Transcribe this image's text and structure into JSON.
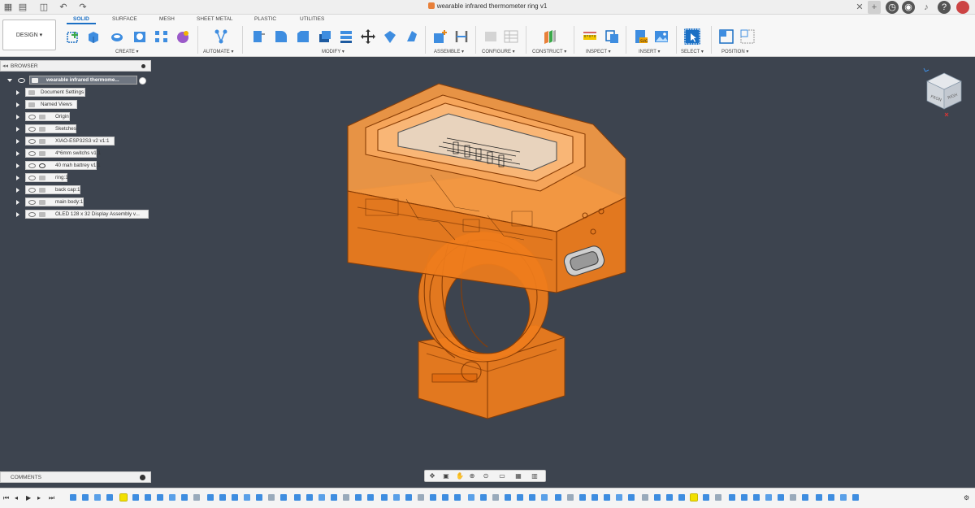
{
  "window": {
    "title": "wearable infrared thermometer ring v1"
  },
  "ribbon": {
    "workspace_button": "DESIGN ▾",
    "tabs": [
      "SOLID",
      "SURFACE",
      "MESH",
      "SHEET METAL",
      "PLASTIC",
      "UTILITIES"
    ],
    "active_tab": "SOLID",
    "groups": [
      "CREATE ▾",
      "AUTOMATE ▾",
      "MODIFY ▾",
      "ASSEMBLE ▾",
      "CONFIGURE ▾",
      "CONSTRUCT ▾",
      "INSPECT ▾",
      "INSERT ▾",
      "SELECT ▾",
      "POSITION ▾"
    ]
  },
  "browser": {
    "header": "BROWSER",
    "root": "wearable infrared thermome...",
    "items": [
      "Document Settings",
      "Named Views",
      "Origin",
      "Sketches",
      "XIAO-ESP32S3 v2 v1:1",
      "4*6mm switchs v1:1",
      "40 mah battrey v1:1",
      "ring:1",
      "back cap:1",
      "main body:1",
      "OLED 128 x 32 Display Assembly v..."
    ]
  },
  "comments": {
    "header": "COMMENTS"
  },
  "colors": {
    "accent": "#1a6fc4",
    "viewport_bg": "#3d444f",
    "model_orange": "#f07d1c",
    "model_edge": "#8a3d05"
  },
  "icons": [
    "grid-icon",
    "file-icon",
    "save-icon",
    "undo-icon",
    "redo-icon",
    "close-icon",
    "add-tab-icon",
    "clock-icon",
    "bell-icon",
    "help-icon",
    "avatar"
  ]
}
